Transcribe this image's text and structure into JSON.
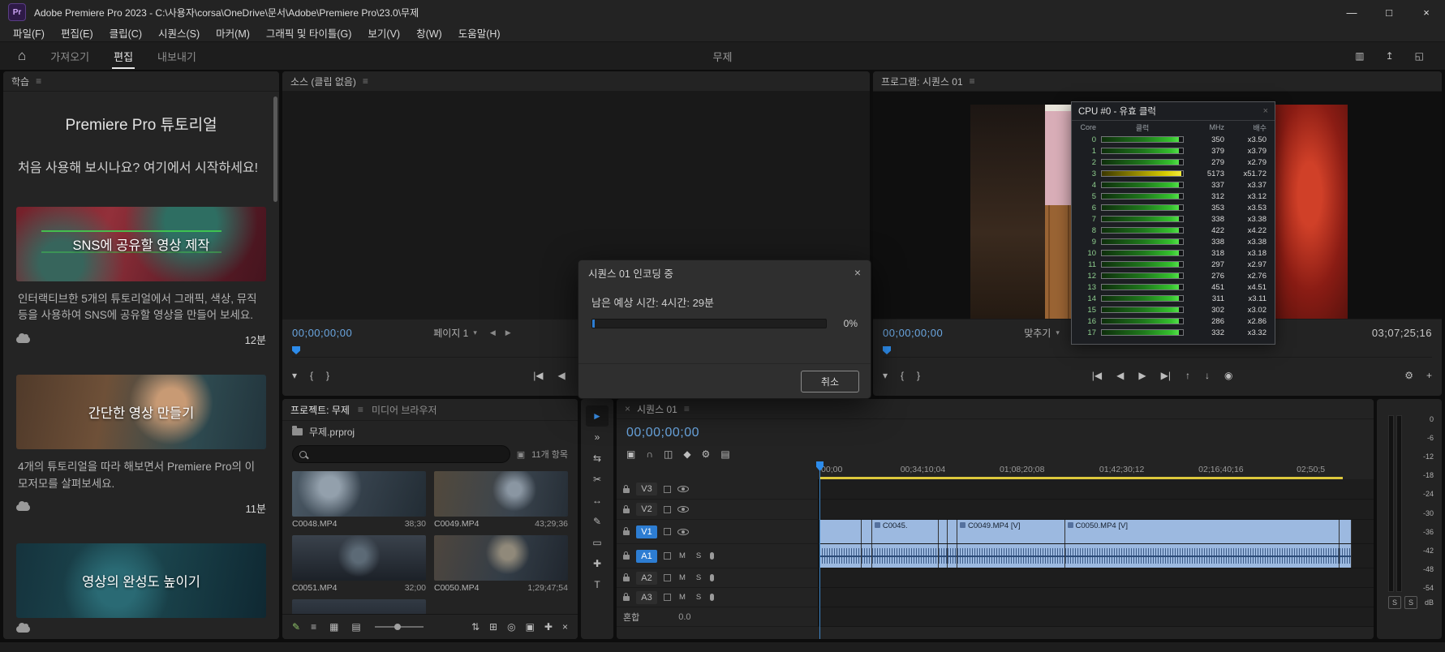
{
  "titlebar": {
    "app_initials": "Pr",
    "title": "Adobe Premiere Pro 2023 - C:\\사용자\\corsa\\OneDrive\\문서\\Adobe\\Premiere Pro\\23.0\\무제",
    "minimize": "—",
    "maximize": "□",
    "close": "×"
  },
  "icons": {
    "panel_menu": "≡",
    "home": "⌂",
    "dropdown": "▾",
    "prev_page": "◀",
    "next_page": "▶",
    "close": "×"
  },
  "menubar": {
    "items": [
      "파일(F)",
      "편집(E)",
      "클립(C)",
      "시퀀스(S)",
      "마커(M)",
      "그래픽 및 타이틀(G)",
      "보기(V)",
      "창(W)",
      "도움말(H)"
    ]
  },
  "workspace": {
    "tabs": [
      {
        "label": "가져오기",
        "state": ""
      },
      {
        "label": "편집",
        "state": "active"
      },
      {
        "label": "내보내기",
        "state": ""
      }
    ],
    "doc_title": "무제",
    "right_icons": [
      {
        "name": "workspaces-icon",
        "glyph": "▥"
      },
      {
        "name": "quick-export-icon",
        "glyph": "↥"
      },
      {
        "name": "fullscreen-icon",
        "glyph": "◱"
      }
    ]
  },
  "learn": {
    "title": "학습",
    "heading": "Premiere Pro 튜토리얼",
    "intro": "처음 사용해 보시나요? 여기에서 시작하세요!",
    "cards": [
      {
        "title": "SNS에 공유할 영상 제작",
        "description": "인터랙티브한 5개의 튜토리얼에서 그래픽, 색상, 뮤직 등을 사용하여 SNS에 공유할 영상을 만들어 보세요.",
        "duration": "12분",
        "thumb": "thumb-sns"
      },
      {
        "title": "간단한 영상 만들기",
        "description": "4개의 튜토리얼을 따라 해보면서 Premiere Pro의 이모저모를 살펴보세요.",
        "duration": "11분",
        "thumb": "thumb-simple"
      },
      {
        "title": "영상의 완성도 높이기",
        "description": "",
        "duration": "",
        "thumb": "thumb-polish"
      }
    ]
  },
  "source": {
    "title": "소스 (클립 없음)",
    "timecode": "00;00;00;00",
    "page_label": "페이지 1",
    "transport_left": [
      {
        "name": "add-marker-icon",
        "glyph": "▾"
      },
      {
        "name": "mark-in-icon",
        "glyph": "{"
      },
      {
        "name": "mark-out-icon",
        "glyph": "}"
      }
    ],
    "transport_center": [
      {
        "name": "go-to-in-icon",
        "glyph": "|◀"
      },
      {
        "name": "step-back-icon",
        "glyph": "◀"
      },
      {
        "name": "play-icon",
        "glyph": "▶"
      },
      {
        "name": "step-forward-icon",
        "glyph": "▶|"
      }
    ],
    "transport_right": [
      {
        "name": "export-frame-icon",
        "glyph": "◉"
      },
      {
        "name": "insert-icon",
        "glyph": "↑"
      },
      {
        "name": "overwrite-icon",
        "glyph": "↓"
      }
    ]
  },
  "program": {
    "title": "프로그램: 시퀀스 01",
    "timecode": "00;00;00;00",
    "fit_label": "맞추기",
    "duration": "03;07;25;16",
    "transport_left": [
      {
        "name": "add-marker-icon",
        "glyph": "▾"
      },
      {
        "name": "mark-in-icon",
        "glyph": "{"
      },
      {
        "name": "mark-out-icon",
        "glyph": "}"
      }
    ],
    "transport_center": [
      {
        "name": "go-to-in-icon",
        "glyph": "|◀"
      },
      {
        "name": "step-back-icon",
        "glyph": "◀"
      },
      {
        "name": "play-icon",
        "glyph": "▶"
      },
      {
        "name": "step-forward-icon",
        "glyph": "▶|"
      },
      {
        "name": "lift-icon",
        "glyph": "↑"
      },
      {
        "name": "extract-icon",
        "glyph": "↓"
      },
      {
        "name": "export-frame-icon",
        "glyph": "◉"
      }
    ],
    "transport_right": [
      {
        "name": "settings-wrench-icon",
        "glyph": "⚙"
      },
      {
        "name": "button-editor-icon",
        "glyph": "+"
      }
    ]
  },
  "cpu": {
    "title": "CPU #0 - 유효 클럭",
    "columns": [
      "Core",
      "클럭",
      "MHz",
      "배수"
    ],
    "rows": [
      {
        "core": "0",
        "mhz": "350",
        "ratio": "x3.50",
        "pct": 95,
        "color": "green"
      },
      {
        "core": "1",
        "mhz": "379",
        "ratio": "x3.79",
        "pct": 95,
        "color": "green"
      },
      {
        "core": "2",
        "mhz": "279",
        "ratio": "x2.79",
        "pct": 95,
        "color": "green"
      },
      {
        "core": "3",
        "mhz": "5173",
        "ratio": "x51.72",
        "pct": 98,
        "color": "yellow"
      },
      {
        "core": "4",
        "mhz": "337",
        "ratio": "x3.37",
        "pct": 95,
        "color": "green"
      },
      {
        "core": "5",
        "mhz": "312",
        "ratio": "x3.12",
        "pct": 95,
        "color": "green"
      },
      {
        "core": "6",
        "mhz": "353",
        "ratio": "x3.53",
        "pct": 95,
        "color": "green"
      },
      {
        "core": "7",
        "mhz": "338",
        "ratio": "x3.38",
        "pct": 95,
        "color": "green"
      },
      {
        "core": "8",
        "mhz": "422",
        "ratio": "x4.22",
        "pct": 95,
        "color": "green"
      },
      {
        "core": "9",
        "mhz": "338",
        "ratio": "x3.38",
        "pct": 95,
        "color": "green"
      },
      {
        "core": "10",
        "mhz": "318",
        "ratio": "x3.18",
        "pct": 95,
        "color": "green"
      },
      {
        "core": "11",
        "mhz": "297",
        "ratio": "x2.97",
        "pct": 95,
        "color": "green"
      },
      {
        "core": "12",
        "mhz": "276",
        "ratio": "x2.76",
        "pct": 95,
        "color": "green"
      },
      {
        "core": "13",
        "mhz": "451",
        "ratio": "x4.51",
        "pct": 95,
        "color": "green"
      },
      {
        "core": "14",
        "mhz": "311",
        "ratio": "x3.11",
        "pct": 95,
        "color": "green"
      },
      {
        "core": "15",
        "mhz": "302",
        "ratio": "x3.02",
        "pct": 95,
        "color": "green"
      },
      {
        "core": "16",
        "mhz": "286",
        "ratio": "x2.86",
        "pct": 95,
        "color": "green"
      },
      {
        "core": "17",
        "mhz": "332",
        "ratio": "x3.32",
        "pct": 95,
        "color": "green"
      }
    ]
  },
  "dialog": {
    "title": "시퀀스 01 인코딩 중",
    "message": "남은 예상 시간: 4시간: 29분",
    "percent": "0%",
    "progress_pct": 1,
    "cancel": "취소"
  },
  "project": {
    "tabs": [
      {
        "label": "프로젝트: 무제",
        "state": "active"
      },
      {
        "label": "미디어 브라우저",
        "state": ""
      }
    ],
    "file_name": "무제.prproj",
    "item_count": "11개 항목",
    "clips": [
      {
        "name": "C0048.MP4",
        "duration": "38;30",
        "thumb": "t1"
      },
      {
        "name": "C0049.MP4",
        "duration": "43;29;36",
        "thumb": "t2"
      },
      {
        "name": "C0051.MP4",
        "duration": "32;00",
        "thumb": "t3"
      },
      {
        "name": "C0050.MP4",
        "duration": "1;29;47;54",
        "thumb": "t4"
      }
    ],
    "toolbar_left": [
      {
        "name": "writable-indicator-icon",
        "glyph": "✎"
      }
    ],
    "toolbar_views": [
      {
        "name": "list-view-icon",
        "glyph": "≡"
      },
      {
        "name": "icon-view-icon",
        "glyph": "▦"
      },
      {
        "name": "freeform-view-icon",
        "glyph": "▤"
      }
    ],
    "toolbar_right": [
      {
        "name": "sort-icon",
        "glyph": "⇅"
      },
      {
        "name": "automate-sequence-icon",
        "glyph": "⊞"
      },
      {
        "name": "find-icon",
        "glyph": "◎"
      },
      {
        "name": "new-bin-icon",
        "glyph": "▣"
      },
      {
        "name": "new-item-icon",
        "glyph": "✚"
      },
      {
        "name": "delete-icon",
        "glyph": "×"
      }
    ]
  },
  "tools": [
    {
      "name": "selection-tool-icon",
      "glyph": "►",
      "state": "active"
    },
    {
      "name": "track-select-tool-icon",
      "glyph": "»",
      "state": ""
    },
    {
      "name": "ripple-edit-tool-icon",
      "glyph": "⇆",
      "state": ""
    },
    {
      "name": "razor-tool-icon",
      "glyph": "✂",
      "state": ""
    },
    {
      "name": "slip-tool-icon",
      "glyph": "↔",
      "state": ""
    },
    {
      "name": "pen-tool-icon",
      "glyph": "✎",
      "state": ""
    },
    {
      "name": "rectangle-tool-icon",
      "glyph": "▭",
      "state": ""
    },
    {
      "name": "hand-tool-icon",
      "glyph": "✚",
      "state": ""
    },
    {
      "name": "type-tool-icon",
      "glyph": "T",
      "state": ""
    }
  ],
  "timeline": {
    "tab": "시퀀스 01",
    "timecode": "00;00;00;00",
    "toolbar": [
      {
        "name": "nest-sequence-icon",
        "glyph": "▣"
      },
      {
        "name": "snap-icon",
        "glyph": "∩"
      },
      {
        "name": "linked-selection-icon",
        "glyph": "◫"
      },
      {
        "name": "add-marker-icon",
        "glyph": "◆"
      },
      {
        "name": "timeline-settings-icon",
        "glyph": "⚙"
      },
      {
        "name": "captions-menu-icon",
        "glyph": "▤"
      }
    ],
    "ruler": [
      {
        "label": "00;00",
        "x": 0.3
      },
      {
        "label": "00;34;10;04",
        "x": 14.6
      },
      {
        "label": "01;08;20;08",
        "x": 32.5
      },
      {
        "label": "01;42;30;12",
        "x": 50.5
      },
      {
        "label": "02;16;40;16",
        "x": 68.4
      },
      {
        "label": "02;50;5",
        "x": 86.1
      }
    ],
    "tracks": {
      "video": [
        {
          "name": "V3"
        },
        {
          "name": "V2"
        },
        {
          "name": "V1"
        }
      ],
      "audio": [
        {
          "name": "A1"
        },
        {
          "name": "A2"
        },
        {
          "name": "A3"
        }
      ],
      "mute_label": "M",
      "solo_label": "S",
      "mix_label": "혼합",
      "mix_value": "0.0"
    },
    "v1_segments": [
      {
        "label": "",
        "w": 7.6,
        "fx": ""
      },
      {
        "label": "",
        "w": 1.9,
        "fx": ""
      },
      {
        "label": "C0045.",
        "w": 12,
        "fx": "fx"
      },
      {
        "label": "",
        "w": 1.6,
        "fx": ""
      },
      {
        "label": "",
        "w": 1.8,
        "fx": ""
      },
      {
        "label": "C0049.MP4 [V]",
        "w": 19.4,
        "fx": "fx"
      },
      {
        "label": "C0050.MP4 [V]",
        "w": 49.6,
        "fx": "fx"
      },
      {
        "label": "",
        "w": 2.2,
        "fx": ""
      }
    ],
    "a1_segments": [
      {
        "w": 7.6
      },
      {
        "w": 1.9
      },
      {
        "w": 12
      },
      {
        "w": 1.6
      },
      {
        "w": 1.8
      },
      {
        "w": 19.4
      },
      {
        "w": 49.6
      },
      {
        "w": 2.2
      }
    ]
  },
  "meter": {
    "scale": [
      "0",
      "-6",
      "-12",
      "-18",
      "-24",
      "-30",
      "-36",
      "-42",
      "-48",
      "-54"
    ],
    "db_label": "dB",
    "solo_buttons": [
      "S",
      "S"
    ]
  }
}
